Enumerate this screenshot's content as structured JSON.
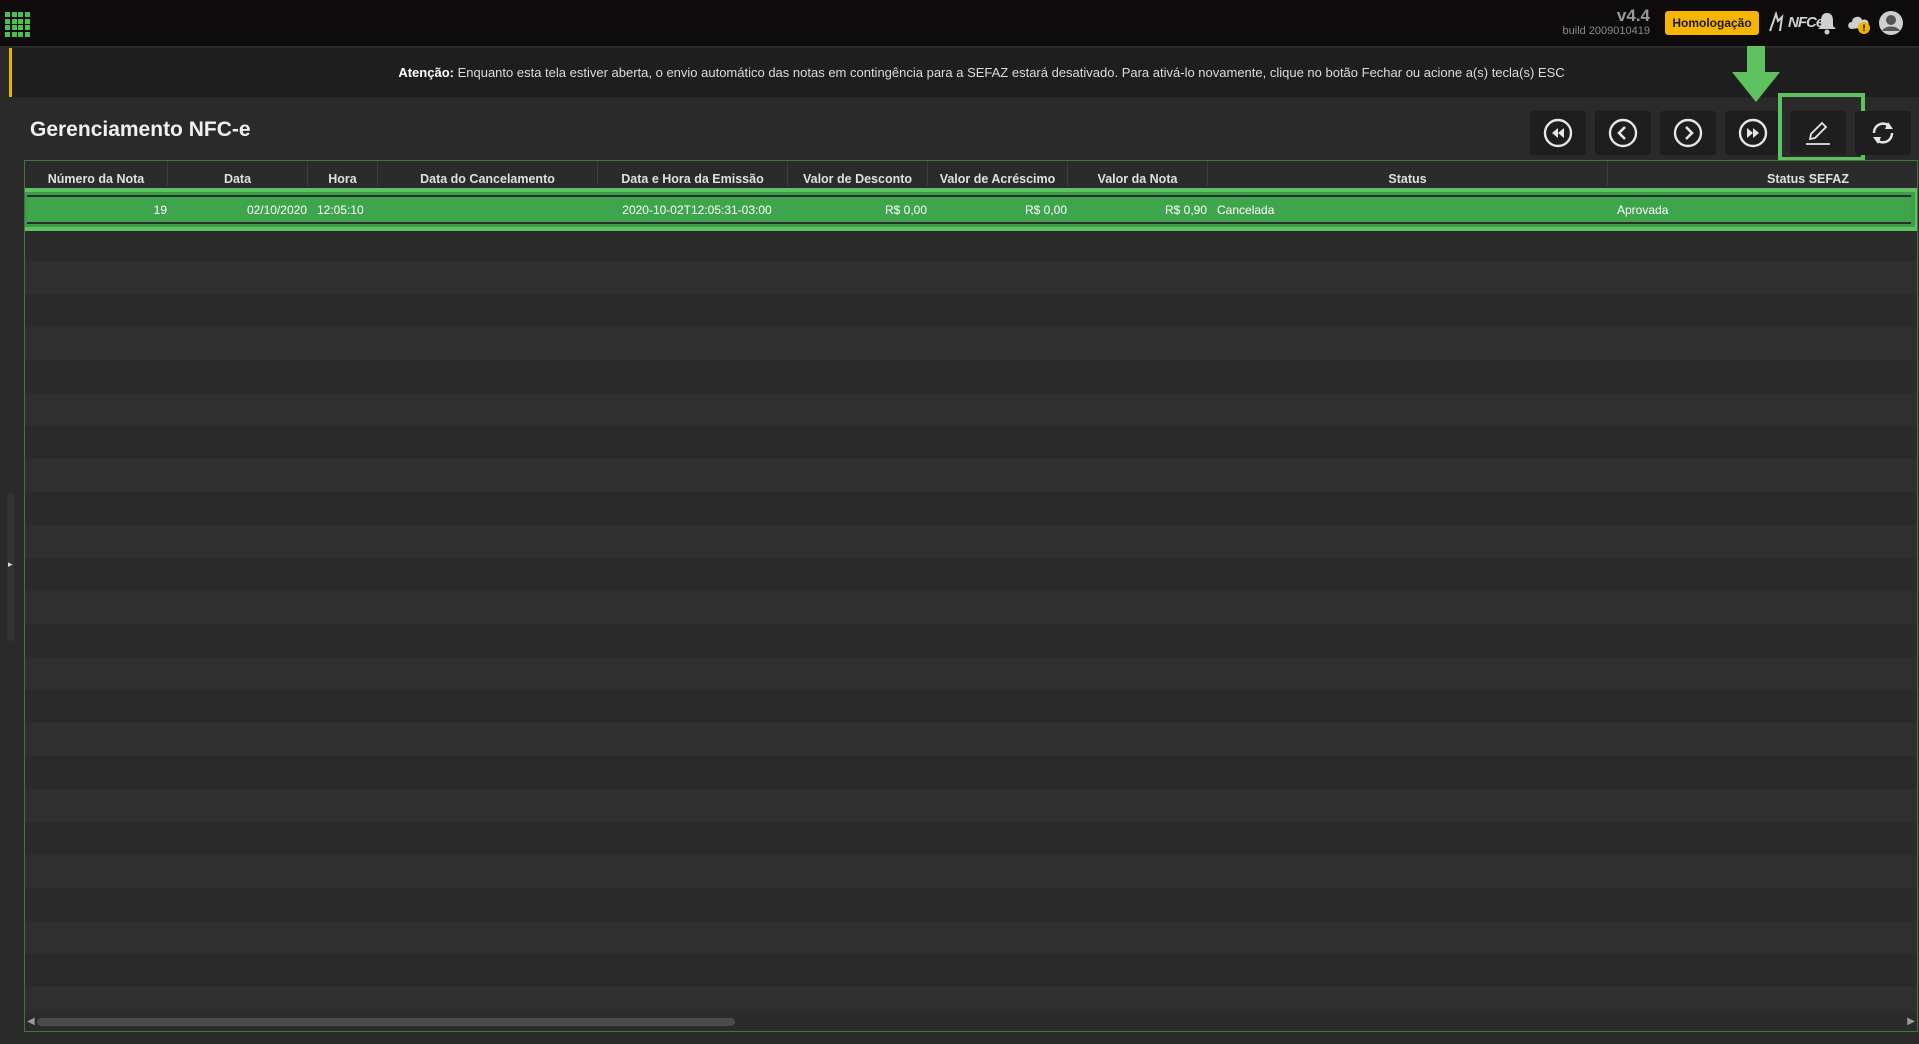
{
  "topbar": {
    "version": "v4.4",
    "build": "build 2009010419",
    "environment_badge": "Homologação",
    "nfce_logo": "NFCe",
    "icons": [
      "apps-grid-icon",
      "nfce-logo",
      "bell-icon",
      "cloud-warning-icon",
      "user-avatar-icon"
    ],
    "colors": {
      "accent": "#4cc04c",
      "badge": "#f7b500",
      "warning": "#e5b300"
    }
  },
  "alert": {
    "prefix": "Atenção:",
    "message": " Enquanto esta tela estiver aberta, o envio automático das notas em contingência para a SEFAZ estará desativado. Para ativá-lo novamente, clique no botão Fechar ou acione a(s) tecla(s) ESC"
  },
  "page": {
    "title": "Gerenciamento NFC-e"
  },
  "toolbar": {
    "buttons": [
      "first-page-icon",
      "previous-page-icon",
      "next-page-icon",
      "last-page-icon",
      "edit-icon",
      "refresh-icon"
    ],
    "highlighted": "edit-icon",
    "highlight_color": "#5ec25e"
  },
  "table": {
    "columns": [
      "Número da Nota",
      "Data",
      "Hora",
      "Data do Cancelamento",
      "Data e Hora da Emissão",
      "Valor de Desconto",
      "Valor de Acréscimo",
      "Valor da Nota",
      "Status",
      "Status SEFAZ"
    ],
    "rows": [
      {
        "numero": "19",
        "data": "02/10/2020",
        "hora": "12:05:10",
        "data_cancelamento": "",
        "emissao": "2020-10-02T12:05:31-03:00",
        "desconto": "R$ 0,00",
        "acrescimo": "R$ 0,00",
        "valor": "R$ 0,90",
        "status": "Cancelada",
        "status_sefaz": "Aprovada"
      }
    ],
    "selected_row_color": "#3ea54d"
  }
}
